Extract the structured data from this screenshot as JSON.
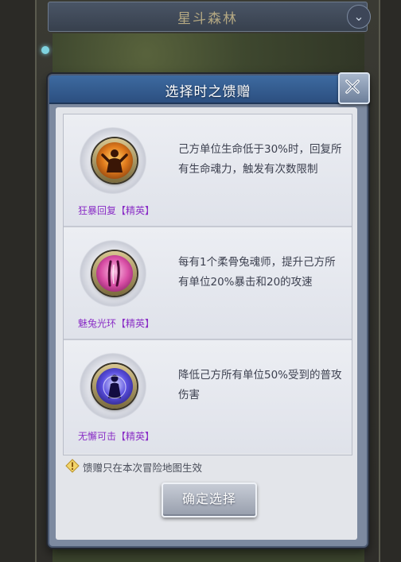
{
  "background": {
    "title": "星斗森林",
    "close_icon": "chevron-down-icon"
  },
  "dialog": {
    "title": "选择时之馈赠",
    "close_icon": "close-icon",
    "options": [
      {
        "name": "狂暴回复【精英】",
        "icon": "rage-recovery-icon",
        "description": "己方单位生命低于30%时，回复所有生命魂力，触发有次数限制"
      },
      {
        "name": "魅兔光环【精英】",
        "icon": "charm-rabbit-aura-icon",
        "description": "每有1个柔骨兔魂师，提升己方所有单位20%暴击和20的攻速"
      },
      {
        "name": "无懈可击【精英】",
        "icon": "invulnerable-icon",
        "description": "降低己方所有单位50%受到的普攻伤害"
      }
    ],
    "note": "馈赠只在本次冒险地图生效",
    "note_icon": "info-icon",
    "confirm_label": "确定选择"
  },
  "colors": {
    "header": "#2c4f80",
    "option_name": "#8a2ec6",
    "description": "#3d4150",
    "button": "#979eac"
  }
}
